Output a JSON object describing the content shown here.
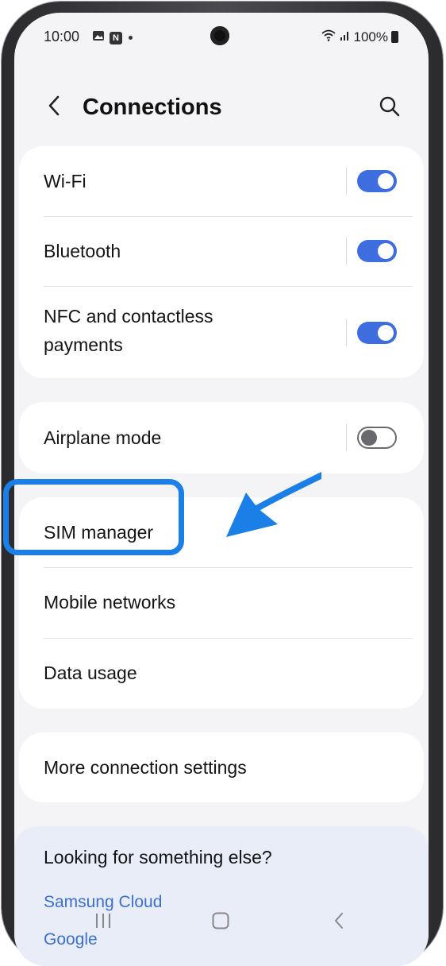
{
  "status_bar": {
    "time": "10:00",
    "notif_n": "N",
    "battery_text": "100%"
  },
  "header": {
    "title": "Connections",
    "back_icon": "chevron-left-icon",
    "search_icon": "search-icon"
  },
  "group1": {
    "items": [
      {
        "label": "Wi-Fi",
        "toggle": "on"
      },
      {
        "label": "Bluetooth",
        "toggle": "on"
      },
      {
        "label_line1": "NFC and contactless",
        "label_line2": "payments",
        "toggle": "on"
      }
    ]
  },
  "group2": {
    "items": [
      {
        "label": "Airplane mode",
        "toggle": "off"
      }
    ]
  },
  "group3": {
    "items": [
      {
        "label": "SIM manager"
      },
      {
        "label": "Mobile networks"
      },
      {
        "label": "Data usage"
      }
    ]
  },
  "group4": {
    "items": [
      {
        "label": "More connection settings"
      }
    ]
  },
  "suggestions": {
    "title": "Looking for something else?",
    "links": [
      "Samsung Cloud",
      "Google"
    ]
  },
  "colors": {
    "accent": "#3e6de0",
    "highlight": "#1a7fe6",
    "link": "#3b6fd0"
  }
}
